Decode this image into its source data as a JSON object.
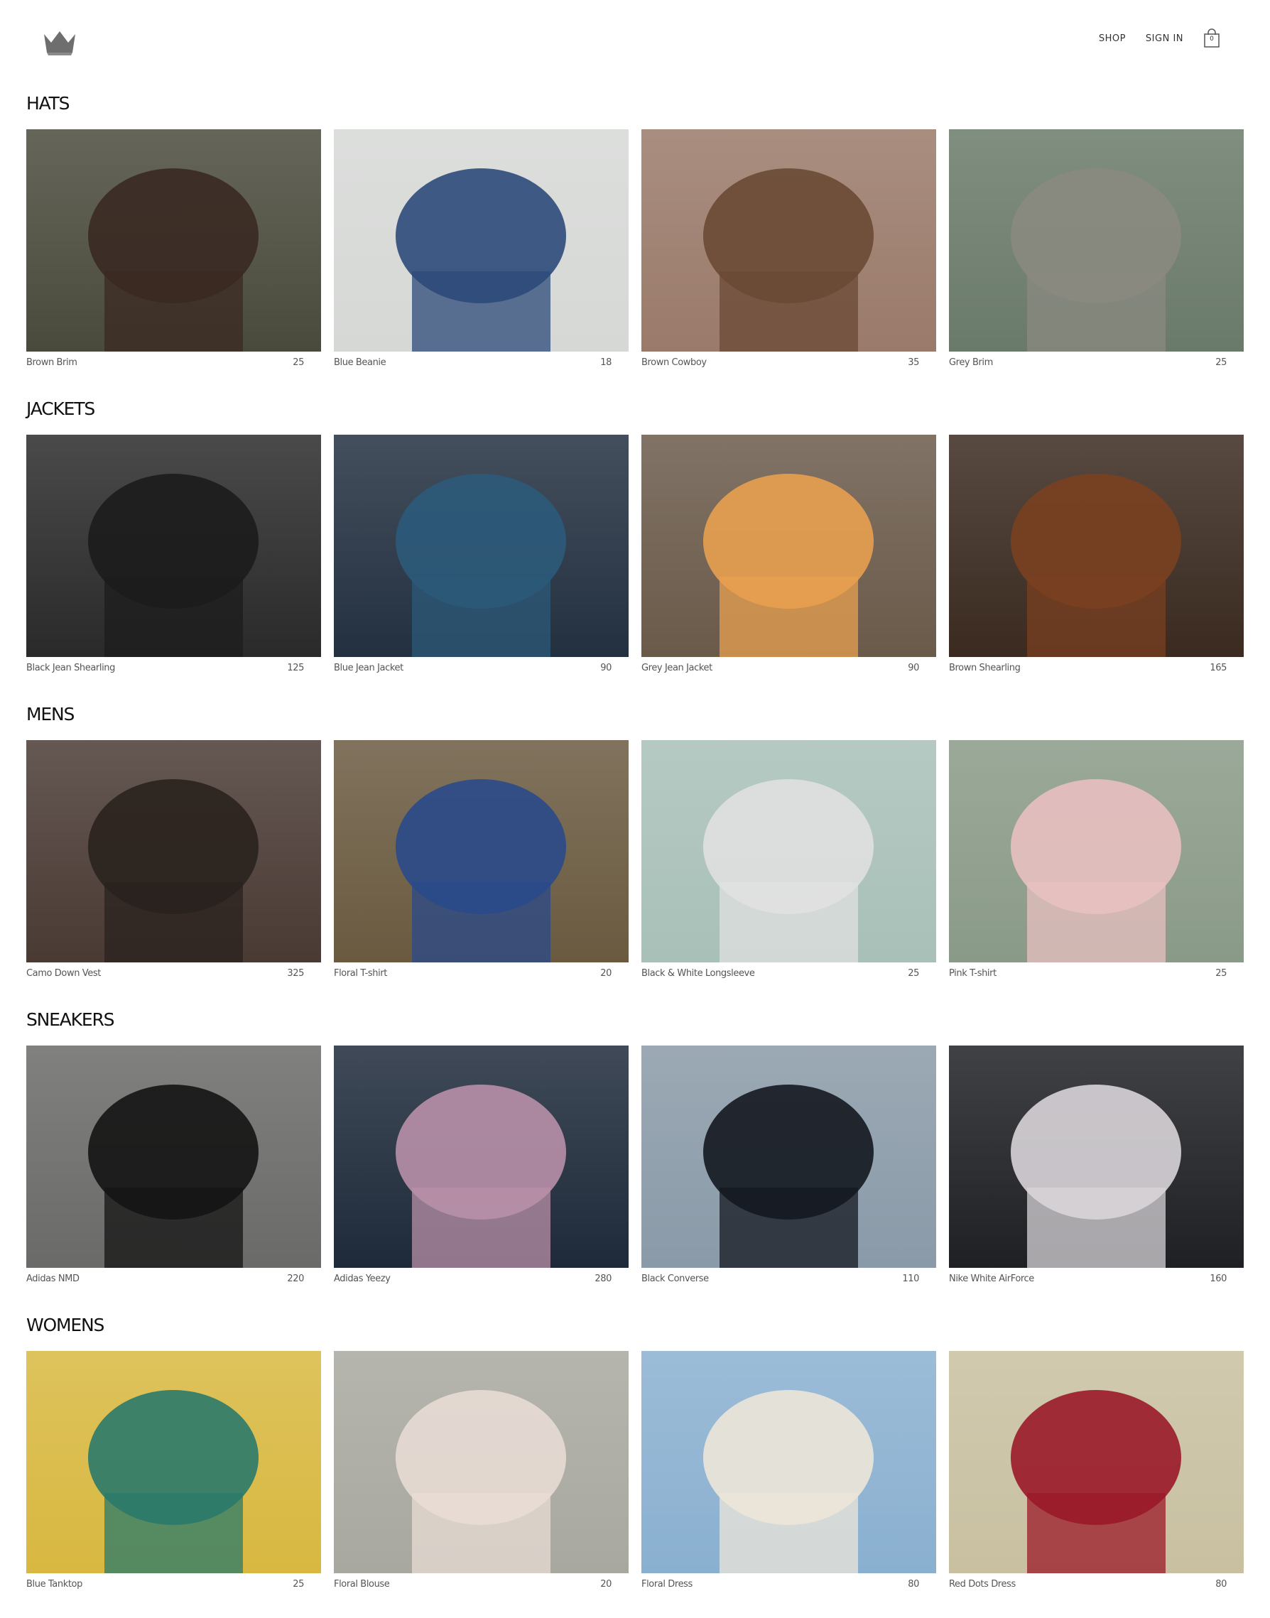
{
  "header": {
    "logo_icon": "crown-icon",
    "nav": {
      "shop": "SHOP",
      "sign_in": "SIGN IN"
    },
    "cart_icon": "shopping-bag-icon",
    "cart_count": "0"
  },
  "sections": [
    {
      "title": "HATS",
      "items": [
        {
          "name": "Brown Brim",
          "price": "25",
          "bg": "#4a4a3c",
          "fg": "#3a2a22"
        },
        {
          "name": "Blue Beanie",
          "price": "18",
          "bg": "#d6d8d6",
          "fg": "#2c4a7a"
        },
        {
          "name": "Brown Cowboy",
          "price": "35",
          "bg": "#9a7a6a",
          "fg": "#6a4a34"
        },
        {
          "name": "Grey Brim",
          "price": "25",
          "bg": "#6a7a6a",
          "fg": "#8a8a80"
        }
      ]
    },
    {
      "title": "JACKETS",
      "items": [
        {
          "name": "Black Jean Shearling",
          "price": "125",
          "bg": "#2a2a2a",
          "fg": "#1c1c1c"
        },
        {
          "name": "Blue Jean Jacket",
          "price": "90",
          "bg": "#233040",
          "fg": "#2c5a7a"
        },
        {
          "name": "Grey Jean Jacket",
          "price": "90",
          "bg": "#6a5a4a",
          "fg": "#e8a050"
        },
        {
          "name": "Brown Shearling",
          "price": "165",
          "bg": "#3a2a20",
          "fg": "#7a4020"
        }
      ]
    },
    {
      "title": "MENS",
      "items": [
        {
          "name": "Camo Down Vest",
          "price": "325",
          "bg": "#4a3a34",
          "fg": "#2a221e"
        },
        {
          "name": "Floral T-shirt",
          "price": "20",
          "bg": "#6a5a40",
          "fg": "#2a4a8a"
        },
        {
          "name": "Black & White Longsleeve",
          "price": "25",
          "bg": "#a8c0b8",
          "fg": "#e0e0e0"
        },
        {
          "name": "Pink T-shirt",
          "price": "25",
          "bg": "#8a9a88",
          "fg": "#e8c0c0"
        }
      ]
    },
    {
      "title": "SNEAKERS",
      "items": [
        {
          "name": "Adidas NMD",
          "price": "220",
          "bg": "#6a6a68",
          "fg": "#141414"
        },
        {
          "name": "Adidas Yeezy",
          "price": "280",
          "bg": "#1e2a3a",
          "fg": "#b890a8"
        },
        {
          "name": "Black Converse",
          "price": "110",
          "bg": "#8a9aa8",
          "fg": "#141820"
        },
        {
          "name": "Nike White AirForce",
          "price": "160",
          "bg": "#1e2024",
          "fg": "#d8d4d8"
        }
      ]
    },
    {
      "title": "WOMENS",
      "items": [
        {
          "name": "Blue Tanktop",
          "price": "25",
          "bg": "#d8b840",
          "fg": "#2a7a6a"
        },
        {
          "name": "Floral Blouse",
          "price": "20",
          "bg": "#a8a8a0",
          "fg": "#e8dcd4"
        },
        {
          "name": "Floral Dress",
          "price": "80",
          "bg": "#8ab0d0",
          "fg": "#ece6d8"
        },
        {
          "name": "Red Dots Dress",
          "price": "80",
          "bg": "#c8c0a0",
          "fg": "#9a1a2a"
        }
      ]
    }
  ]
}
